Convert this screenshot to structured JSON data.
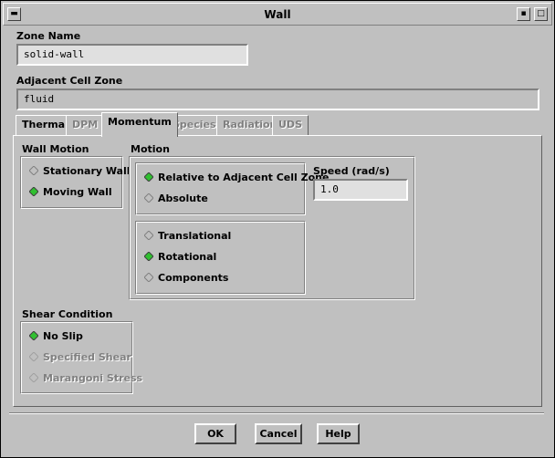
{
  "window": {
    "title": "Wall"
  },
  "zone_name": {
    "label": "Zone Name",
    "value": "solid-wall"
  },
  "adjacent_cell_zone": {
    "label": "Adjacent Cell Zone",
    "value": "fluid"
  },
  "tabs": [
    {
      "label": "Thermal",
      "state": "enabled"
    },
    {
      "label": "DPM",
      "state": "disabled"
    },
    {
      "label": "Momentum",
      "state": "active"
    },
    {
      "label": "Species",
      "state": "disabled"
    },
    {
      "label": "Radiation",
      "state": "disabled"
    },
    {
      "label": "UDS",
      "state": "disabled"
    }
  ],
  "wall_motion": {
    "label": "Wall Motion",
    "options": [
      {
        "label": "Stationary Wall",
        "selected": false
      },
      {
        "label": "Moving Wall",
        "selected": true
      }
    ]
  },
  "motion": {
    "label": "Motion",
    "reference": [
      {
        "label": "Relative to Adjacent Cell Zone",
        "selected": true
      },
      {
        "label": "Absolute",
        "selected": false
      }
    ],
    "type": [
      {
        "label": "Translational",
        "selected": false
      },
      {
        "label": "Rotational",
        "selected": true
      },
      {
        "label": "Components",
        "selected": false
      }
    ],
    "speed": {
      "label": "Speed (rad/s)",
      "value": "1.0"
    }
  },
  "shear_condition": {
    "label": "Shear Condition",
    "options": [
      {
        "label": "No Slip",
        "selected": true,
        "disabled": false
      },
      {
        "label": "Specified Shear",
        "selected": false,
        "disabled": true
      },
      {
        "label": "Marangoni Stress",
        "selected": false,
        "disabled": true
      }
    ]
  },
  "buttons": {
    "ok": "OK",
    "cancel": "Cancel",
    "help": "Help"
  },
  "colors": {
    "background": "#c0c0c0",
    "selected_radio": "#30c030"
  }
}
